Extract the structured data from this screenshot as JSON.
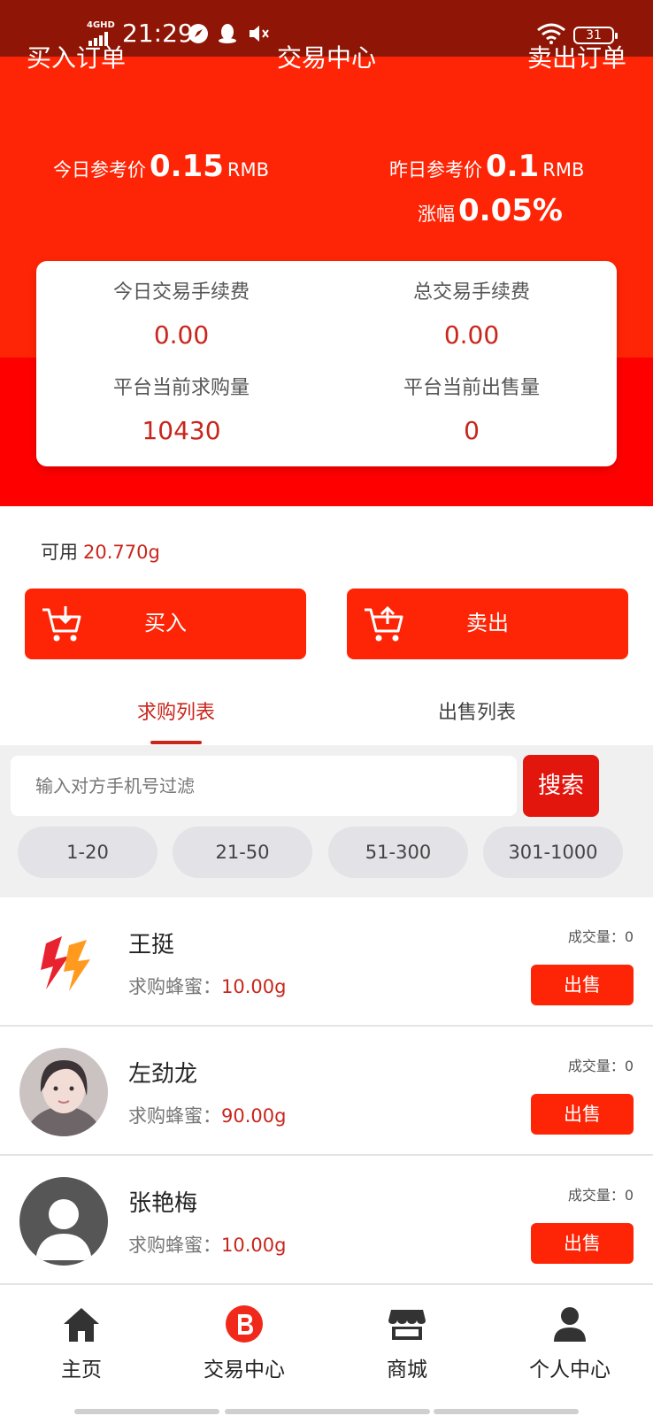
{
  "status_bar": {
    "network": "4GHD",
    "time": "21:29",
    "battery": "31",
    "icons": [
      "compass-icon",
      "penguin-icon",
      "mute-icon",
      "wifi-icon",
      "battery-icon"
    ]
  },
  "header": {
    "left_link": "买入订单",
    "title": "交易中心",
    "right_link": "卖出订单"
  },
  "prices": {
    "today_label": "今日参考价",
    "today_value": "0.15",
    "today_unit": "RMB",
    "yesterday_label": "昨日参考价",
    "yesterday_value": "0.1",
    "yesterday_unit": "RMB",
    "change_label": "涨幅",
    "change_value": "0.05%"
  },
  "stats": {
    "today_fee_label": "今日交易手续费",
    "today_fee_value": "0.00",
    "total_fee_label": "总交易手续费",
    "total_fee_value": "0.00",
    "buy_volume_label": "平台当前求购量",
    "buy_volume_value": "10430",
    "sell_volume_label": "平台当前出售量",
    "sell_volume_value": "0"
  },
  "balance": {
    "label": "可用",
    "value": "20.770g"
  },
  "actions": {
    "buy_label": "买入",
    "sell_label": "卖出"
  },
  "tabs": {
    "buy_list": "求购列表",
    "sell_list": "出售列表",
    "active": "buy_list"
  },
  "filter": {
    "placeholder": "输入对方手机号过滤",
    "search_label": "搜索",
    "ranges": [
      "1-20",
      "21-50",
      "51-300",
      "301-1000"
    ]
  },
  "list": [
    {
      "name": "王挺",
      "buy_label": "求购蜂蜜：",
      "amount": "10.00g",
      "deal_label": "成交量：0",
      "action": "出售",
      "avatar": "lightning-logo"
    },
    {
      "name": "左劲龙",
      "buy_label": "求购蜂蜜：",
      "amount": "90.00g",
      "deal_label": "成交量：0",
      "action": "出售",
      "avatar": "photo"
    },
    {
      "name": "张艳梅",
      "buy_label": "求购蜂蜜：",
      "amount": "10.00g",
      "deal_label": "成交量：0",
      "action": "出售",
      "avatar": "default-person"
    }
  ],
  "bottom_nav": [
    {
      "label": "主页",
      "icon": "home-icon"
    },
    {
      "label": "交易中心",
      "icon": "trade-b-icon",
      "active": true
    },
    {
      "label": "商城",
      "icon": "store-icon"
    },
    {
      "label": "个人中心",
      "icon": "person-icon"
    }
  ],
  "colors": {
    "primary_red": "#fe2506",
    "dark_red": "#8f1606",
    "accent_text": "#c8261c"
  }
}
